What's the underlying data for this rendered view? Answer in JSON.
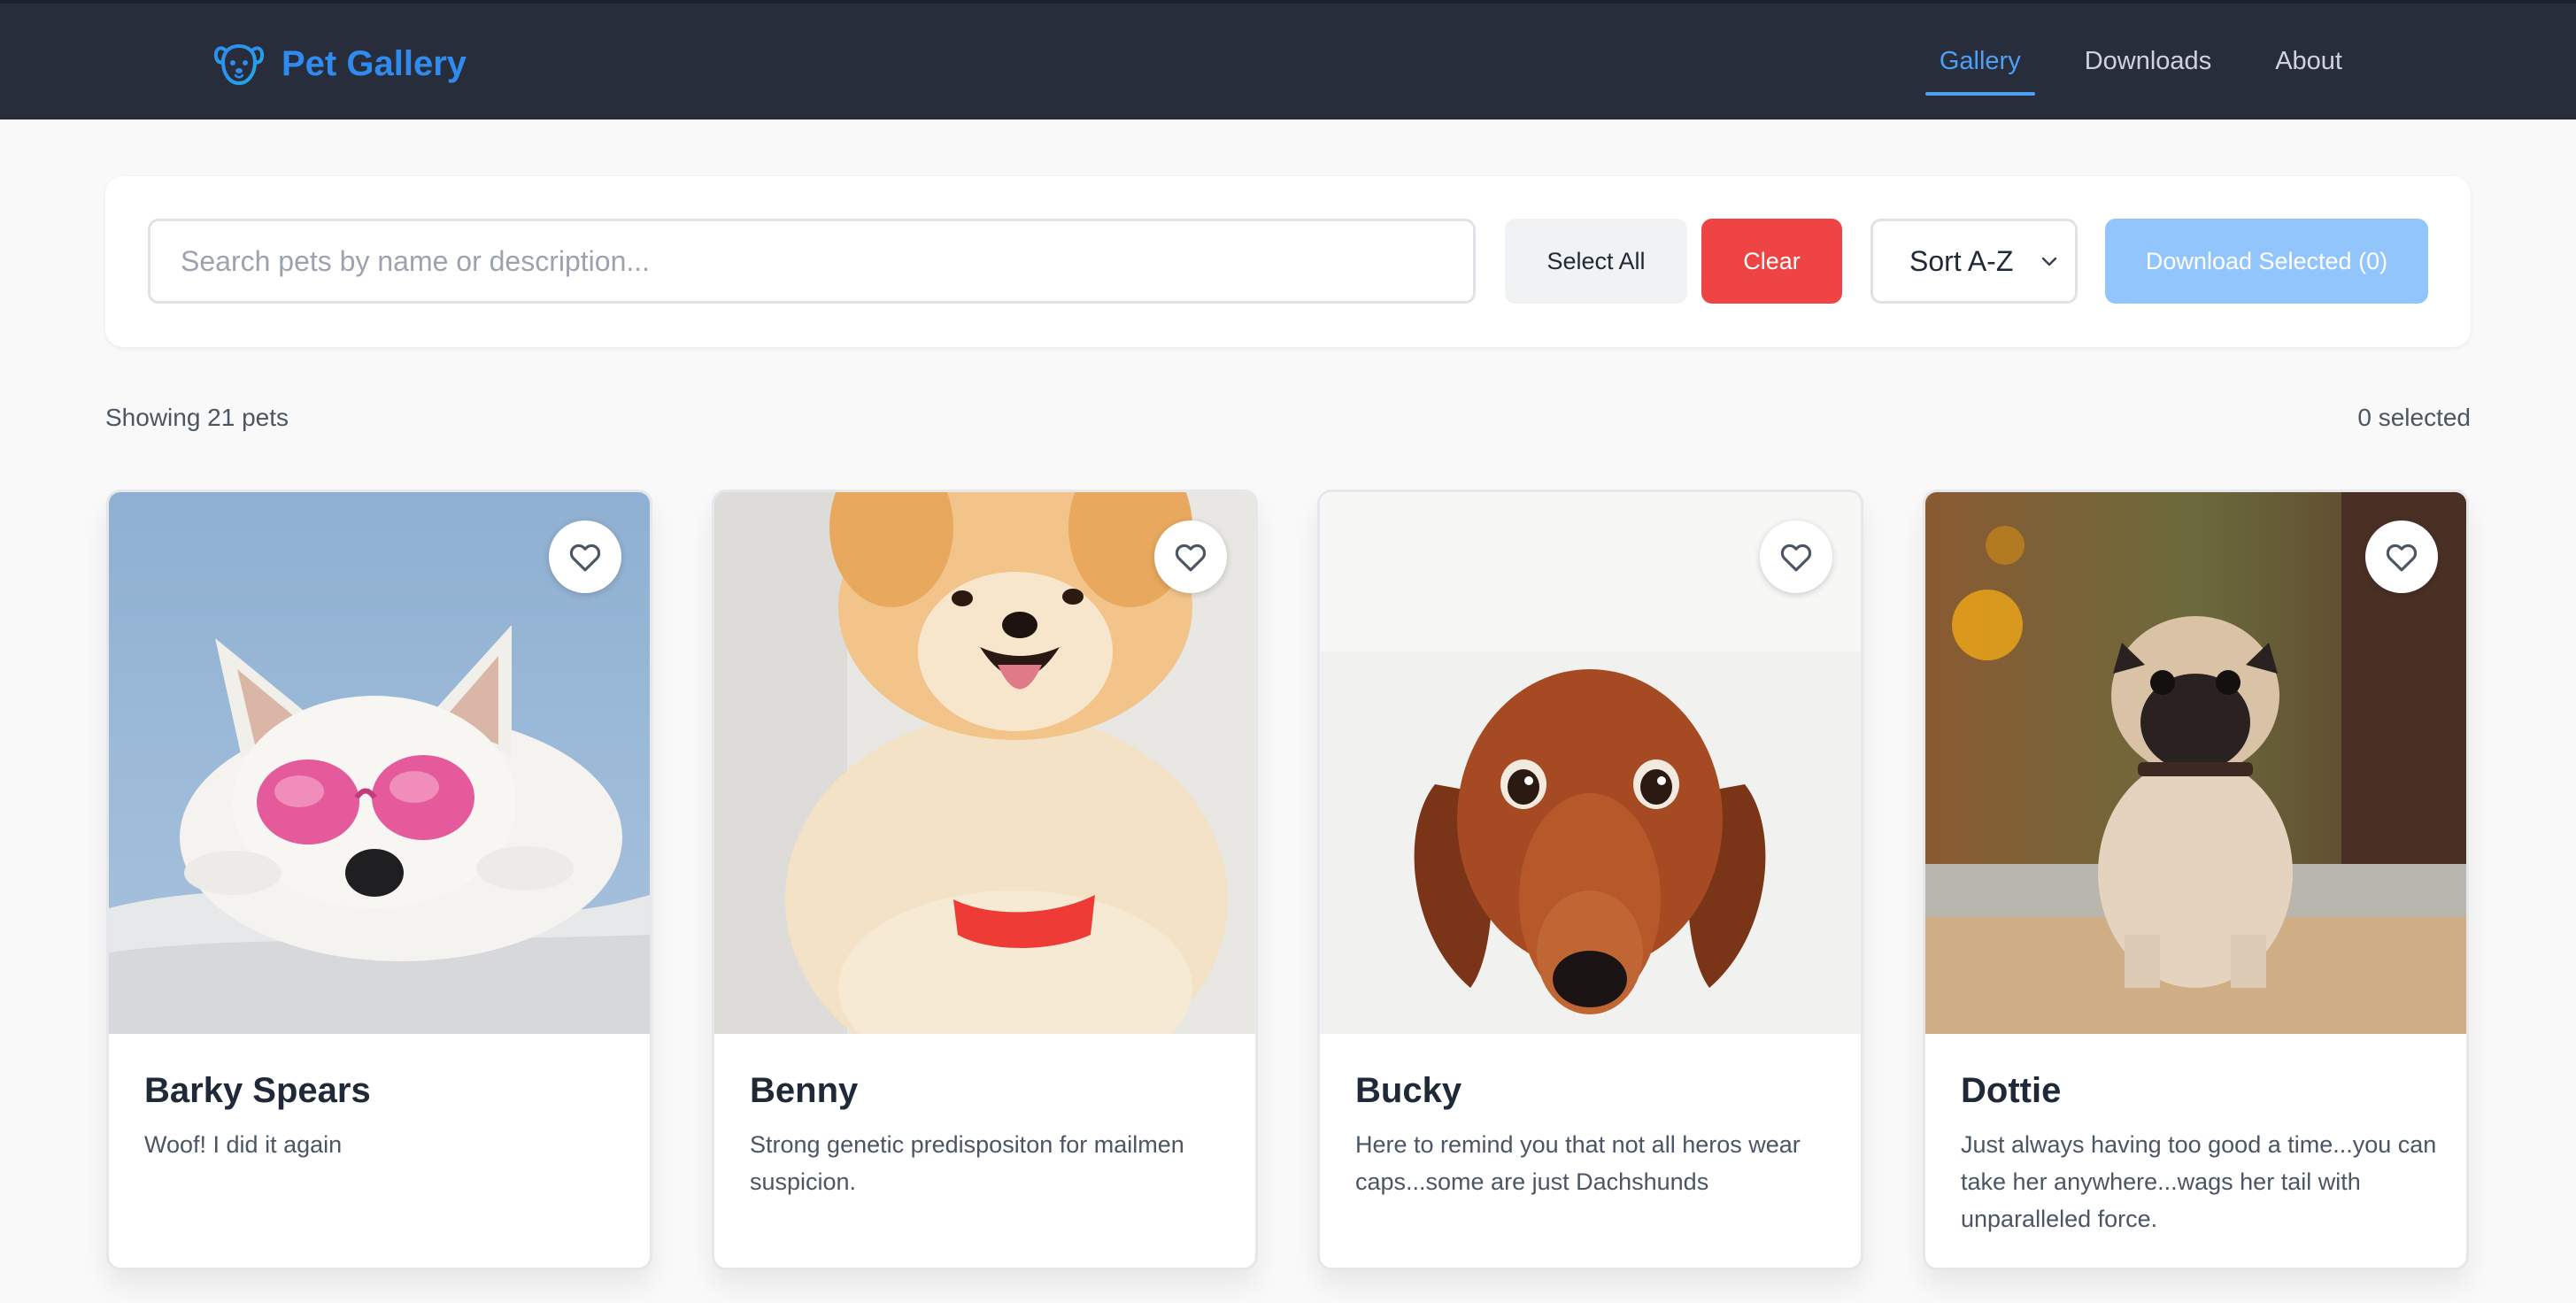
{
  "app": {
    "name": "Pet Gallery",
    "accent": "#2f8bf0"
  },
  "nav": {
    "items": [
      {
        "label": "Gallery",
        "active": true
      },
      {
        "label": "Downloads",
        "active": false
      },
      {
        "label": "About",
        "active": false
      }
    ]
  },
  "toolbar": {
    "search_placeholder": "Search pets by name or description...",
    "search_value": "",
    "select_all_label": "Select All",
    "clear_label": "Clear",
    "sort_value": "Sort A-Z",
    "download_label": "Download Selected (0)"
  },
  "results": {
    "count_text": "Showing 21 pets",
    "selected_text": "0 selected"
  },
  "pets": [
    {
      "name": "Barky Spears",
      "description": "Woof! I did it again",
      "favorited": false
    },
    {
      "name": "Benny",
      "description": "Strong genetic predispositon for mailmen suspicion.",
      "favorited": false
    },
    {
      "name": "Bucky",
      "description": "Here to remind you that not all heros wear caps...some are just Dachshunds",
      "favorited": false
    },
    {
      "name": "Dottie",
      "description": "Just always having too good a time...you can take her anywhere...wags her tail with unparalleled force.",
      "favorited": false
    }
  ],
  "icons": {
    "brand": "dog-face-icon",
    "favorite": "heart-outline-icon",
    "sort": "chevron-down-icon"
  },
  "colors": {
    "header_bg": "#282d3b",
    "nav_active": "#4ea0f6",
    "clear_button": "#ef4444",
    "download_button": "#93c5fd"
  }
}
